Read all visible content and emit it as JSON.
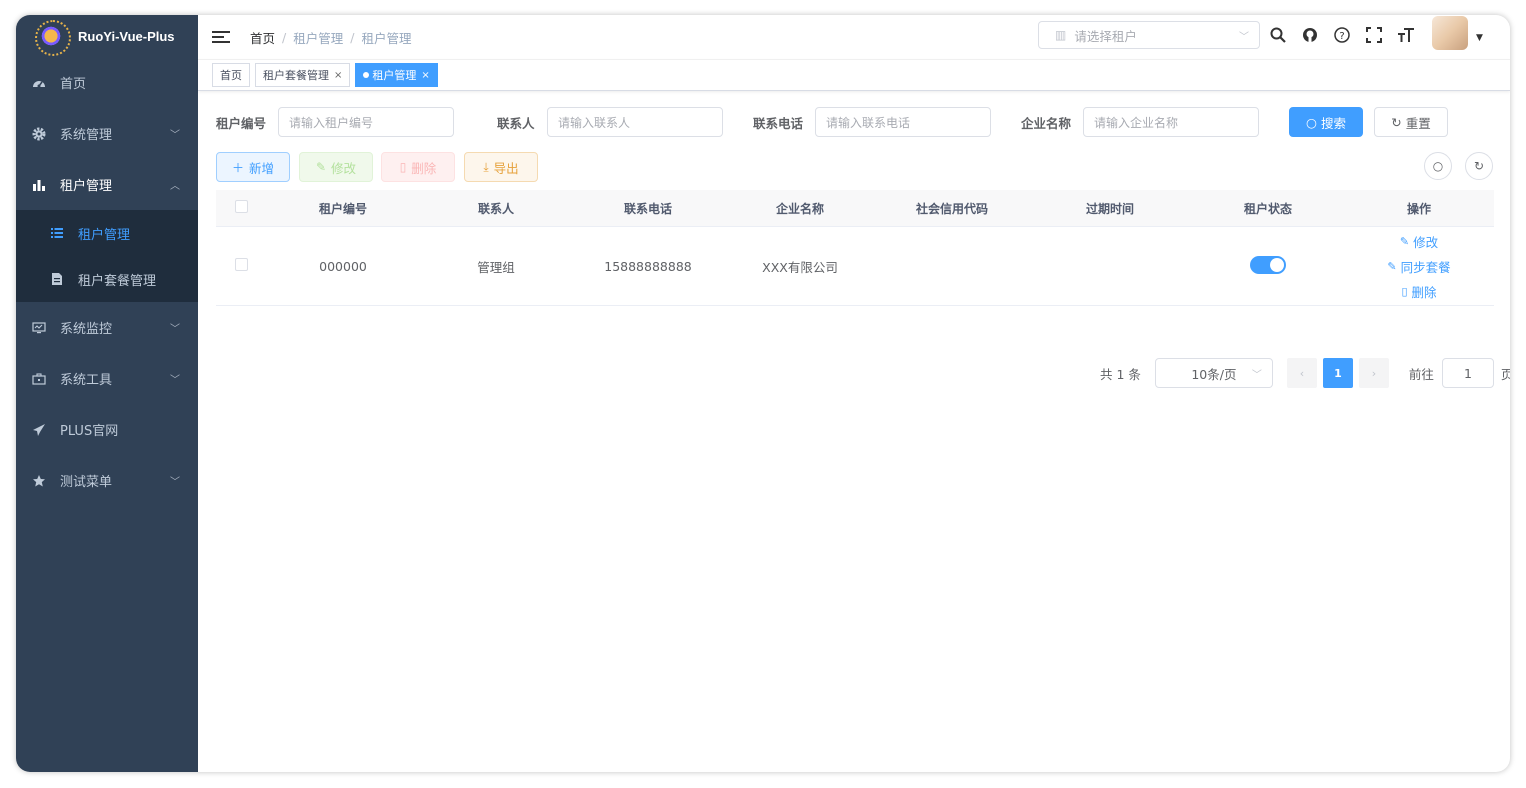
{
  "app": {
    "title": "RuoYi-Vue-Plus"
  },
  "sidebar": {
    "items": [
      {
        "label": "首页",
        "icon": "dashboard-icon"
      },
      {
        "label": "系统管理",
        "icon": "gear-icon",
        "expandable": true
      },
      {
        "label": "租户管理",
        "icon": "bar-chart-icon",
        "expandable": true,
        "open": true,
        "children": [
          {
            "label": "租户管理",
            "icon": "list-icon",
            "active": true
          },
          {
            "label": "租户套餐管理",
            "icon": "document-icon"
          }
        ]
      },
      {
        "label": "系统监控",
        "icon": "monitor-icon",
        "expandable": true
      },
      {
        "label": "系统工具",
        "icon": "toolbox-icon",
        "expandable": true
      },
      {
        "label": "PLUS官网",
        "icon": "paper-plane-icon"
      },
      {
        "label": "测试菜单",
        "icon": "star-icon",
        "expandable": true
      }
    ]
  },
  "navbar": {
    "breadcrumb": [
      "首页",
      "租户管理",
      "租户管理"
    ],
    "tenant_select_placeholder": "请选择租户"
  },
  "tags": [
    {
      "label": "首页"
    },
    {
      "label": "租户套餐管理",
      "closable": true
    },
    {
      "label": "租户管理",
      "closable": true,
      "active": true
    }
  ],
  "search": {
    "tenant_id_label": "租户编号",
    "tenant_id_placeholder": "请输入租户编号",
    "contact_label": "联系人",
    "contact_placeholder": "请输入联系人",
    "phone_label": "联系电话",
    "phone_placeholder": "请输入联系电话",
    "company_label": "企业名称",
    "company_placeholder": "请输入企业名称",
    "search_button": "搜索",
    "reset_button": "重置"
  },
  "toolbar": {
    "add": "新增",
    "edit": "修改",
    "delete": "删除",
    "export": "导出"
  },
  "table": {
    "columns": [
      "租户编号",
      "联系人",
      "联系电话",
      "企业名称",
      "社会信用代码",
      "过期时间",
      "租户状态",
      "操作"
    ],
    "rows": [
      {
        "tenant_id": "000000",
        "contact": "管理组",
        "phone": "15888888888",
        "company": "XXX有限公司",
        "credit_code": "",
        "expire_time": "",
        "status_on": true,
        "actions": [
          "修改",
          "同步套餐",
          "删除"
        ]
      }
    ]
  },
  "pagination": {
    "total_text": "共 1 条",
    "page_size": "10条/页",
    "current_page": "1",
    "goto_label": "前往",
    "goto_value": "1",
    "page_suffix": "页"
  },
  "colors": {
    "sidebar_bg": "#304156",
    "accent": "#409eff"
  }
}
